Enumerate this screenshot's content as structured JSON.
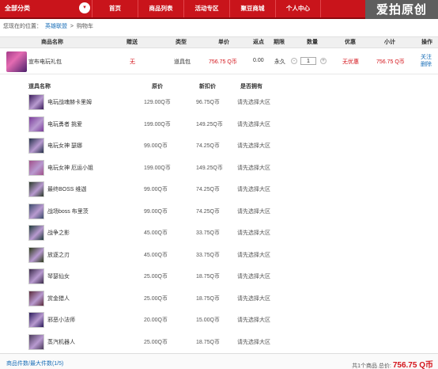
{
  "nav": {
    "all_categories": "全部分类",
    "caret": "▾",
    "items": [
      "首页",
      "商品列表",
      "活动专区",
      "聚豆商城",
      "个人中心"
    ],
    "logo_text": "爱拍原创"
  },
  "breadcrumb": {
    "label": "您现在的位置：",
    "items": [
      "英雄联盟",
      ">",
      "购物车"
    ]
  },
  "table_header": {
    "name": "商品名称",
    "gift": "赠送",
    "type": "类型",
    "price": "单价",
    "points": "返点",
    "period": "期限",
    "qty": "数量",
    "discount": "优惠",
    "subtotal": "小计",
    "ops": "操作"
  },
  "product": {
    "name": "宣布电玩礼包",
    "gift": "无",
    "type": "道具包",
    "price": "756.75 Q币",
    "points": "0.00",
    "period": "永久",
    "qty": "1",
    "minus": "-",
    "plus": "+",
    "discount": "无优惠",
    "subtotal": "756.75 Q币",
    "op_follow": "关注",
    "op_delete": "删除"
  },
  "sub_header": {
    "name": "道具名称",
    "price": "原价",
    "new_price": "新扣价",
    "owned": "是否拥有"
  },
  "items": [
    {
      "name": "电玩战魂赫卡里姆",
      "price": "129.00Q币",
      "new_price": "96.75Q币",
      "owned": "请先选择大区"
    },
    {
      "name": "电玩勇者 挑爱",
      "price": "199.00Q币",
      "new_price": "149.25Q币",
      "owned": "请先选择大区"
    },
    {
      "name": "电玩女神 瑟娜",
      "price": "99.00Q币",
      "new_price": "74.25Q币",
      "owned": "请先选择大区"
    },
    {
      "name": "电玩女神 厄运小姐",
      "price": "199.00Q币",
      "new_price": "149.25Q币",
      "owned": "请先选择大区"
    },
    {
      "name": "最终BOSS 维迦",
      "price": "99.00Q币",
      "new_price": "74.25Q币",
      "owned": "请先选择大区"
    },
    {
      "name": "战场boss 布里茨",
      "price": "99.00Q币",
      "new_price": "74.25Q币",
      "owned": "请先选择大区"
    },
    {
      "name": "战争之影",
      "price": "45.00Q币",
      "new_price": "33.75Q币",
      "owned": "请先选择大区"
    },
    {
      "name": "放逐之刃",
      "price": "45.00Q币",
      "new_price": "33.75Q币",
      "owned": "请先选择大区"
    },
    {
      "name": "琴瑟仙女",
      "price": "25.00Q币",
      "new_price": "18.75Q币",
      "owned": "请先选择大区"
    },
    {
      "name": "赏金猎人",
      "price": "25.00Q币",
      "new_price": "18.75Q币",
      "owned": "请先选择大区"
    },
    {
      "name": "邪恶小法师",
      "price": "20.00Q币",
      "new_price": "15.00Q币",
      "owned": "请先选择大区"
    },
    {
      "name": "蒸汽机器人",
      "price": "25.00Q币",
      "new_price": "18.75Q币",
      "owned": "请先选择大区"
    }
  ],
  "footer": {
    "left": "商品件数/最大件数(1/5)",
    "summary": "共1个商品 总价:",
    "total": "756.75 Q币"
  },
  "colors": {
    "brand_red": "#c9141b",
    "price_red": "#d4141b",
    "link_blue": "#1a6fb8"
  },
  "item_icon_colors": [
    "#3a1c5a",
    "#7a3c9a",
    "#24304a",
    "#a0508a",
    "#2a3a2a",
    "#3a4a6a",
    "#1f3a3a",
    "#2c3a1a",
    "#3a2a4a",
    "#5a2a3a",
    "#2a1a5a",
    "#4a3a5a"
  ]
}
